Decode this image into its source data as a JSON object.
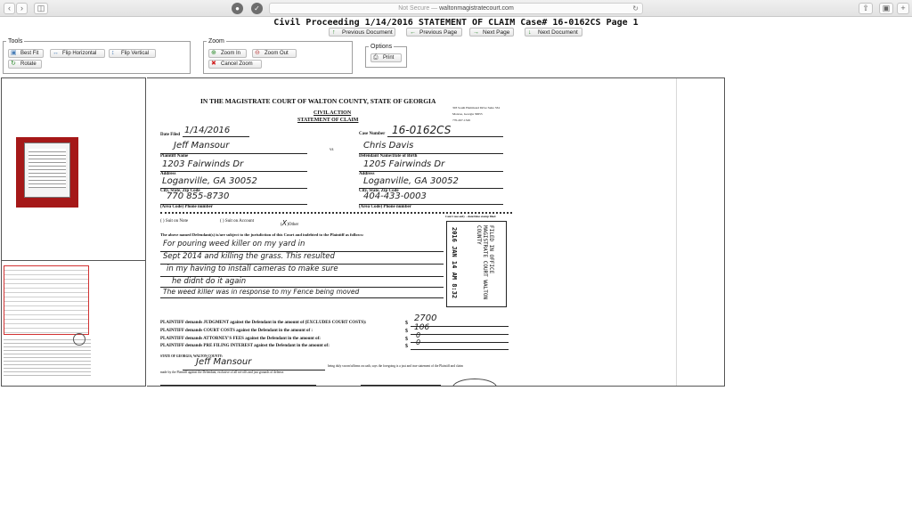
{
  "browser": {
    "url_prefix": "Not Secure —",
    "url_host": "waltonmagistratecourt.com"
  },
  "doc_title": "Civil Proceeding 1/14/2016 STATEMENT OF CLAIM Case# 16-0162CS Page 1",
  "nav": {
    "prev_doc": "Previous Document",
    "prev_page": "Previous Page",
    "next_page": "Next Page",
    "next_doc": "Next Document"
  },
  "tools": {
    "legend": "Tools",
    "best_fit": "Best Fit",
    "flip_h": "Flip Horizontal",
    "flip_v": "Flip Vertical",
    "rotate": "Rotate"
  },
  "zoom": {
    "legend": "Zoom",
    "zoom_in": "Zoom In",
    "zoom_out": "Zoom Out",
    "cancel": "Cancel Zoom"
  },
  "options": {
    "legend": "Options",
    "print": "Print"
  },
  "document": {
    "court_title": "IN THE MAGISTRATE COURT OF WALTON COUNTY, STATE OF GEORGIA",
    "court_addr1": "303 South Hammond Drive Suite 334",
    "court_addr2": "Monroe, Georgia 30655",
    "court_phone": "770-267-1349",
    "civil_action": "CIVIL ACTION",
    "statement": "STATEMENT OF CLAIM",
    "date_filed_label": "Date Filed",
    "date_filed": "1/14/2016",
    "case_number_label": "Case Number",
    "case_number": "16-0162CS",
    "plaintiff_name": "Jeff Mansour",
    "plaintiff_name_label": "Plaintiff Name",
    "vs": "vs",
    "defendant_name": "Chris Davis",
    "defendant_name_label": "Defendant Name/Date of Birth",
    "plaintiff_address": "1203 Fairwinds Dr",
    "defendant_address": "1205 Fairwinds Dr",
    "address_label": "Address",
    "plaintiff_city": "Loganville, GA 30052",
    "defendant_city": "Loganville, GA 30052",
    "city_label": "City, State, Zip Code",
    "plaintiff_phone": "770 855-8730",
    "defendant_phone": "404-433-0003",
    "phone_label": "(Area Code) Phone number",
    "suit_note": "Suit on Note",
    "suit_account": "Suit on Account",
    "other": "Other",
    "stamp_label": "Court use only - date/time stamp filed",
    "stamp_date": "2016 JAN 14 AM 8:32",
    "stamp_text": "FILED IN OFFICE MAGISTRATE COURT WALTON COUNTY",
    "claim_intro": "The above named Defendant(s) is/are subject to the jurisdiction of this Court and indebted to the Plaintiff as follows:",
    "claim_lines": [
      "For pouring weed killer on my yard in",
      "Sept 2014 and killing the grass. This resulted",
      "in my having to install cameras to make sure",
      "he didnt do it again",
      "The weed killer was in response to my Fence being moved"
    ],
    "demands": [
      {
        "text": "PLAINTIFF demands JUDGMENT against the Defendant in the amount of (EXCLUDES COURT COSTS):",
        "amount": "2700"
      },
      {
        "text": "PLAINTIFF demands COURT COSTS against the Defendant in the amount of :",
        "amount": "106"
      },
      {
        "text": "PLAINTIFF demands ATTORNEY'S FEES against the Defendant in the amount of:",
        "amount": "0"
      },
      {
        "text": "PLAINTIFF demands PRE FILING INTEREST against the Defendant in the amount of:",
        "amount": "0"
      }
    ],
    "currency": "$",
    "state_county": "STATE OF GEORGIA, WALTON COUNTY:",
    "affiant_name": "Jeff Mansour",
    "oath_text": "being duly sworn/affirms on oath, says the foregoing is a just and true statement of the Plaintiff and claim",
    "oath_text2": "made by the Plaintiff against the Defendant, exclusive of all set-offs and just grounds of defense."
  }
}
